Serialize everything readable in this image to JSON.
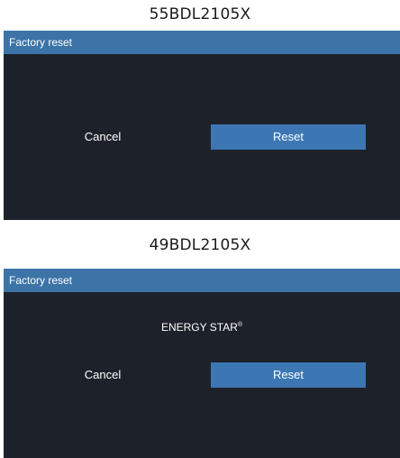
{
  "panels": [
    {
      "model": "55BDL2105X",
      "title": "Factory reset",
      "cancel_label": "Cancel",
      "reset_label": "Reset"
    },
    {
      "model": "49BDL2105X",
      "title": "Factory reset",
      "badge_text": "ENERGY STAR",
      "badge_mark": "®",
      "cancel_label": "Cancel",
      "reset_label": "Reset"
    }
  ],
  "colors": {
    "dialog_background": "#1d222a",
    "title_bar": "#3d74a8",
    "reset_button": "#3c77b4",
    "text": "#ffffff"
  }
}
